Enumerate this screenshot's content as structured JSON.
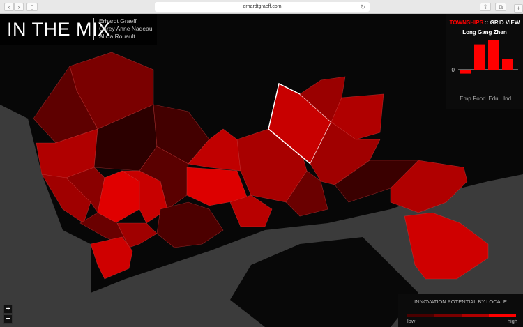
{
  "browser": {
    "url": "erhardtgraeff.com",
    "back": "‹",
    "forward": "›",
    "sidebar": "▯",
    "share": "⇪",
    "tabs": "⧉",
    "reload": "↻",
    "new_tab": "+"
  },
  "header": {
    "title": "IN THE MIX",
    "authors": [
      "Erhardt Graeff",
      "Carey Anne Nadeau",
      "Alicia Rouault"
    ]
  },
  "panel": {
    "mode_a": "TOWNSHIPS",
    "mode_sep": " :: ",
    "mode_b": "GRID VIEW",
    "township": "Long Gang Zhen"
  },
  "chart_data": {
    "type": "bar",
    "categories": [
      "Emp",
      "Food",
      "Edu",
      "Ind"
    ],
    "values": [
      -0.2,
      1.3,
      1.5,
      0.55
    ],
    "zero_label": "0",
    "ylim": [
      -0.3,
      1.6
    ],
    "color": "#ff0000"
  },
  "legend": {
    "title": "INNOVATION POTENTIAL BY LOCALE",
    "low": "low",
    "high": "high",
    "colors": [
      "#4a0000",
      "#7a0000",
      "#b00000",
      "#ff0000"
    ]
  },
  "zoom": {
    "in": "+",
    "out": "−"
  }
}
